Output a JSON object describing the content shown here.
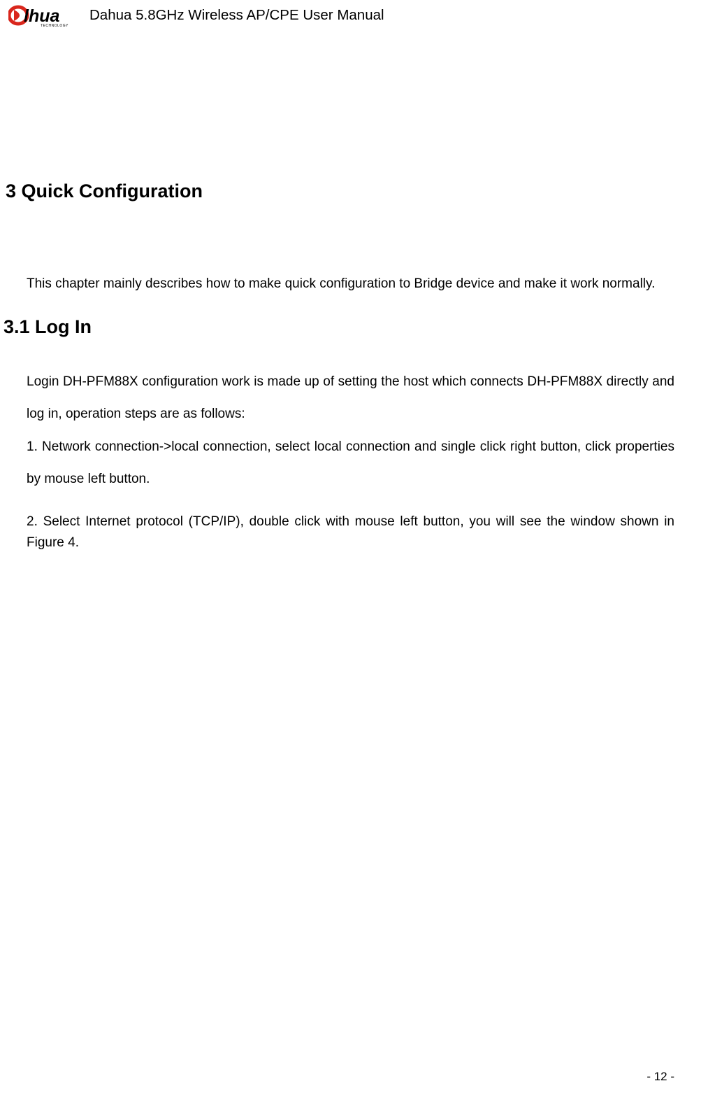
{
  "header": {
    "title": "Dahua 5.8GHz Wireless AP/CPE User Manual",
    "logo_text": "alhua",
    "logo_subtext": "TECHNOLOGY"
  },
  "content": {
    "chapter_heading": "3  Quick Configuration",
    "intro_para": "This chapter mainly describes how to make quick configuration to Bridge device and make it work normally.",
    "section_heading": "3.1 Log In",
    "login_para": "Login DH-PFM88X configuration work is made up of setting the host which connects DH-PFM88X directly and log in, operation steps are as follows:",
    "step1_para": "1. Network connection->local connection, select local connection and single click right button, click properties by mouse left button.",
    "step2_para": "2. Select Internet protocol (TCP/IP), double click with mouse left button, you will see the window shown in Figure 4."
  },
  "footer": {
    "page_number": "-  12  -"
  }
}
